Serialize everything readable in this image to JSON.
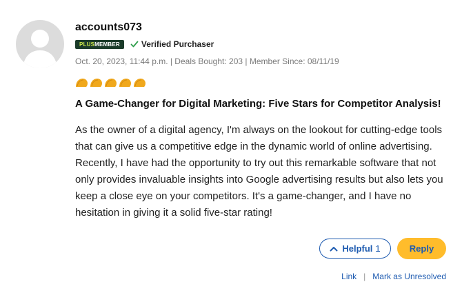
{
  "review": {
    "username": "accounts073",
    "badge": {
      "plus": "PLUS",
      "member": "MEMBER"
    },
    "verified_label": "Verified Purchaser",
    "meta": "Oct. 20, 2023, 11:44 p.m. | Deals Bought: 203 | Member Since: 08/11/19",
    "rating": {
      "value": 5,
      "max": 5,
      "icon": "taco-icon"
    },
    "title": "A Game-Changer for Digital Marketing: Five Stars for Competitor Analysis!",
    "body": "As the owner of a digital agency, I'm always on the lookout for cutting-edge tools that can give us a competitive edge in the dynamic world of online advertising. Recently, I have had the opportunity to try out this remarkable software that not only provides invaluable insights into Google advertising results but also lets you keep a close eye on your competitors. It's a game-changer, and I have no hesitation in giving it a solid five-star rating!"
  },
  "actions": {
    "helpful_label": "Helpful",
    "helpful_count": "1",
    "reply_label": "Reply"
  },
  "links": {
    "link_label": "Link",
    "separator": "|",
    "unresolved_label": "Mark as Unresolved"
  },
  "colors": {
    "accent": "#1e5bb0",
    "reply_bg": "#ffbc2b",
    "taco": "#f0a81c",
    "badge_bg": "#1b3b2a",
    "verified_check": "#2e9d4a"
  }
}
